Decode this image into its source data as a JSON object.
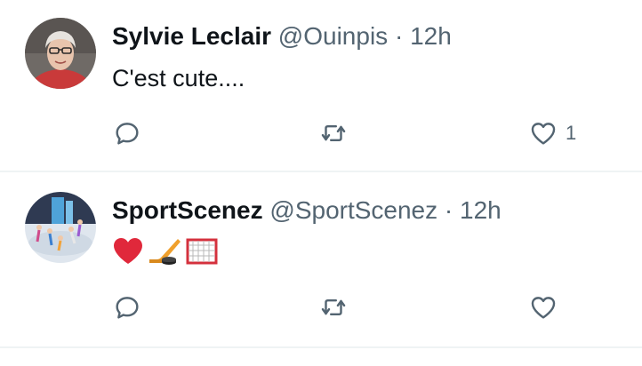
{
  "tweets": [
    {
      "author_name": "Sylvie Leclair",
      "handle": "@Ouinpis",
      "separator": "·",
      "time": "12h",
      "text": "C'est cute....",
      "reply_count": "",
      "retweet_count": "",
      "like_count": "1",
      "avatar": "profile-photo"
    },
    {
      "author_name": "SportScenez",
      "handle": "@SportScenez",
      "separator": "·",
      "time": "12h",
      "emojis": [
        "red-heart",
        "ice-hockey",
        "goal-net"
      ],
      "reply_count": "",
      "retweet_count": "",
      "like_count": "",
      "avatar": "figure-skating-photo"
    }
  ],
  "icons": {
    "reply": "speech-bubble-icon",
    "retweet": "retweet-arrows-icon",
    "like": "heart-outline-icon"
  },
  "colors": {
    "text_primary": "#0f1419",
    "text_secondary": "#536471",
    "divider": "#eff3f4"
  }
}
